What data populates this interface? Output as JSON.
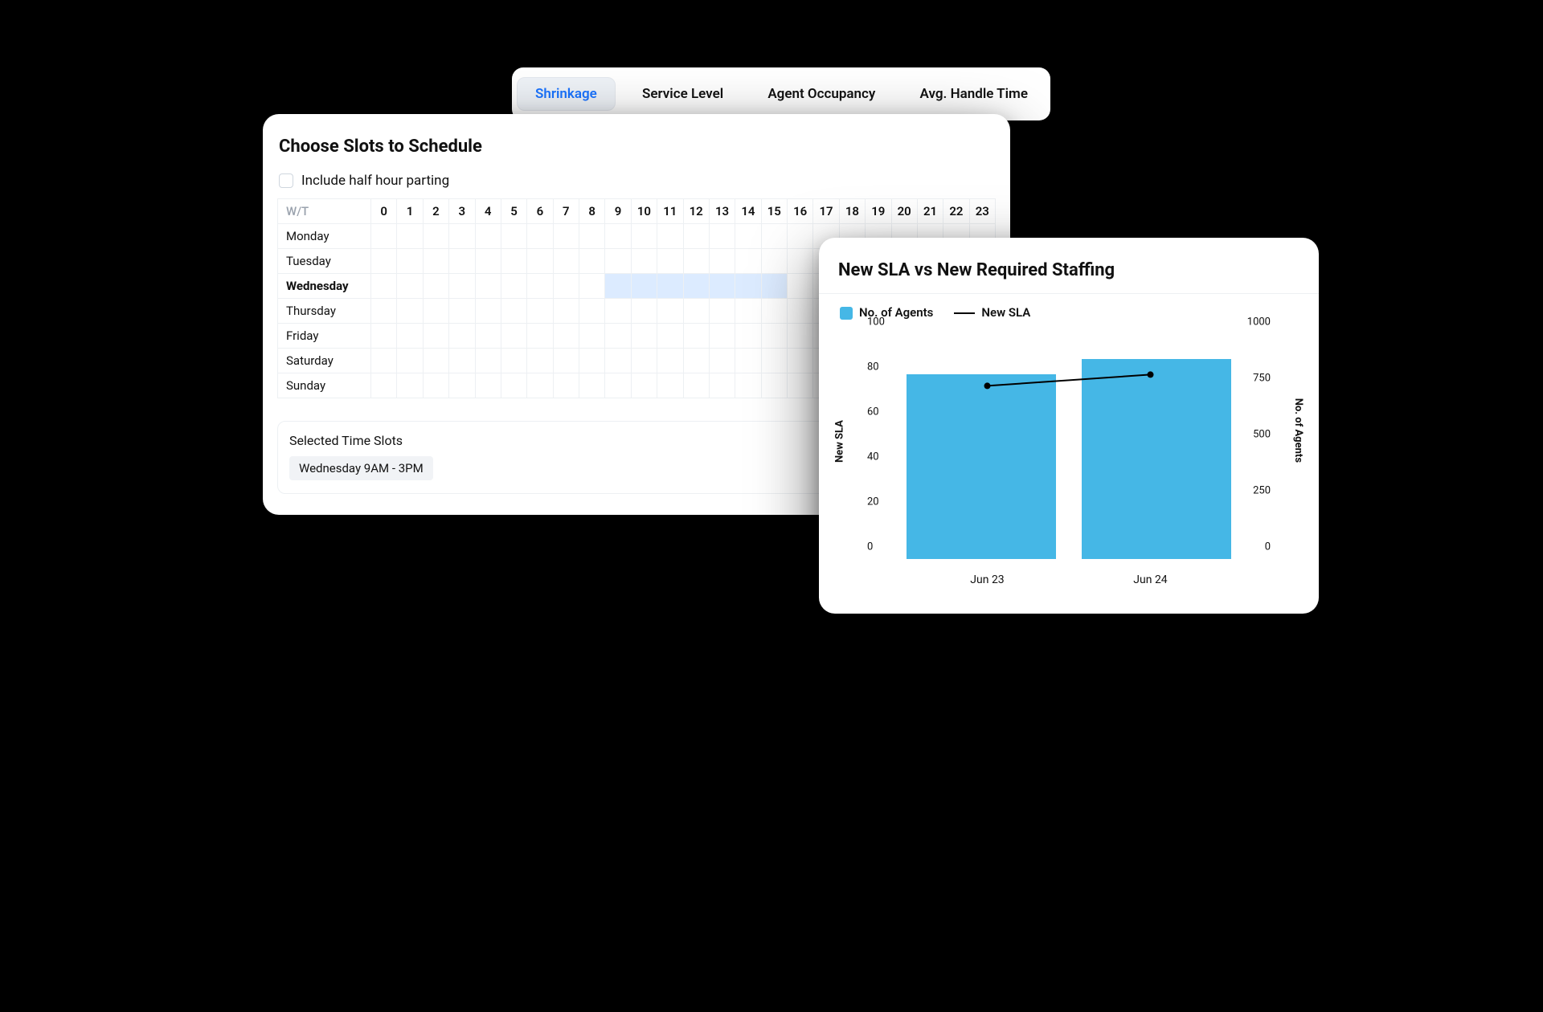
{
  "tabs": [
    "Shrinkage",
    "Service Level",
    "Agent Occupancy",
    "Avg. Handle Time"
  ],
  "active_tab": 0,
  "schedule": {
    "title": "Choose Slots to Schedule",
    "include_half_hour_label": "Include half hour parting",
    "corner": "W/T",
    "hours": [
      "0",
      "1",
      "2",
      "3",
      "4",
      "5",
      "6",
      "7",
      "8",
      "9",
      "10",
      "11",
      "12",
      "13",
      "14",
      "15",
      "16",
      "17",
      "18",
      "19",
      "20",
      "21",
      "22",
      "23"
    ],
    "days": [
      "Monday",
      "Tuesday",
      "Wednesday",
      "Thursday",
      "Friday",
      "Saturday",
      "Sunday"
    ],
    "selected_day_index": 2,
    "selected_hour_start": 9,
    "selected_hour_end_exclusive": 16,
    "selected_block_title": "Selected Time Slots",
    "selected_chip": "Wednesday 9AM - 3PM"
  },
  "chart": {
    "title": "New SLA vs New Required Staffing",
    "legend": {
      "bars": "No. of Agents",
      "line": "New SLA"
    },
    "ylabel_left": "New SLA",
    "ylabel_right": "No. of Agents",
    "yticks_left": [
      0,
      20,
      40,
      60,
      80,
      100
    ],
    "yticks_right": [
      0,
      250,
      500,
      750,
      1000
    ],
    "bar_color": "#45b7e6"
  },
  "chart_data": {
    "type": "bar+line",
    "categories": [
      "Jun 23",
      "Jun 24"
    ],
    "series": [
      {
        "name": "No. of Agents",
        "kind": "bar",
        "axis": "right",
        "values": [
          820,
          890
        ]
      },
      {
        "name": "New SLA",
        "kind": "line",
        "axis": "left",
        "values": [
          77,
          82
        ]
      }
    ],
    "ylim_left": [
      0,
      100
    ],
    "ylim_right": [
      0,
      1000
    ],
    "ylabel_left": "New SLA",
    "ylabel_right": "No. of Agents",
    "title": "New SLA vs New Required Staffing"
  }
}
